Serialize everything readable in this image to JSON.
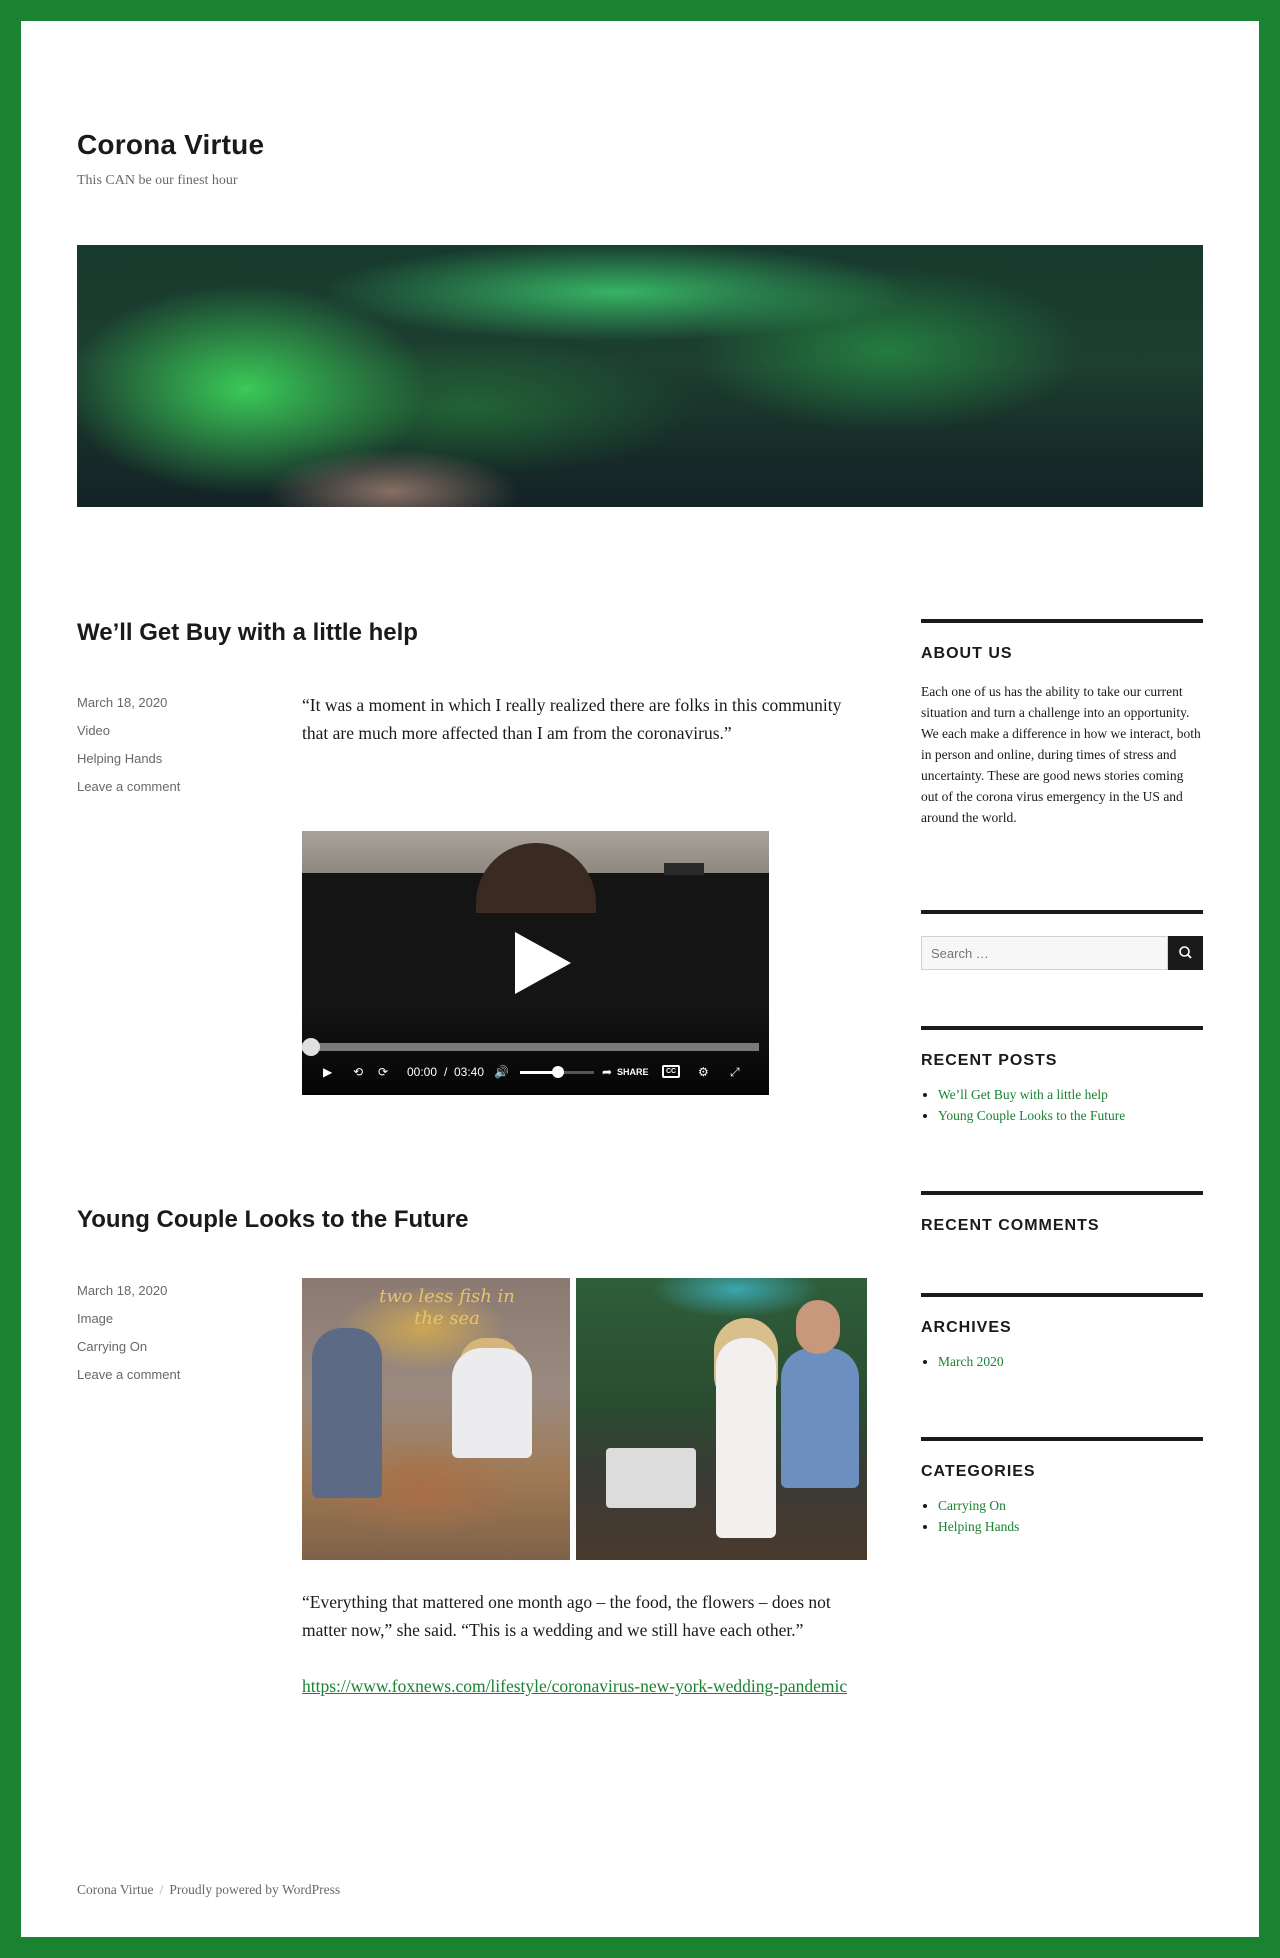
{
  "site": {
    "title": "Corona Virtue",
    "description": "This CAN be our finest hour"
  },
  "posts": [
    {
      "title": "We’ll Get Buy with a little help",
      "meta": {
        "date": "March 18, 2020",
        "format": "Video",
        "category": "Helping Hands",
        "comments": "Leave a comment"
      },
      "quote": "“It was a moment in which I really realized there are folks in this community that are much more affected than I am from the coronavirus.”",
      "video": {
        "time_current": "00:00",
        "time_separator": "/",
        "time_total": "03:40",
        "share_label": "SHARE",
        "cc_label": "CC",
        "volume_level": 0.52,
        "progress": 0
      }
    },
    {
      "title": "Young Couple Looks to the Future",
      "meta": {
        "date": "March 18, 2020",
        "format": "Image",
        "category": "Carrying On",
        "comments": "Leave a comment"
      },
      "image_text": "two less fish in the sea",
      "quote": "“Everything that mattered one month ago – the food, the flowers – does not matter now,” she said. “This is a wedding and we still have each other.”",
      "link": "https://www.foxnews.com/lifestyle/coronavirus-new-york-wedding-pandemic"
    }
  ],
  "sidebar": {
    "about": {
      "heading": "ABOUT US",
      "text": "Each one of us has the ability to take our current situation and turn a challenge into an opportunity.  We each make a difference in how we interact, both in person and online, during times of stress and uncertainty. These are good news stories coming out of the corona virus emergency in the US and around the world."
    },
    "search": {
      "placeholder": "Search …"
    },
    "recent_posts": {
      "heading": "RECENT POSTS",
      "items": [
        "We’ll Get Buy with a little help",
        "Young Couple Looks to the Future"
      ]
    },
    "recent_comments": {
      "heading": "RECENT COMMENTS"
    },
    "archives": {
      "heading": "ARCHIVES",
      "items": [
        "March 2020"
      ]
    },
    "categories": {
      "heading": "CATEGORIES",
      "items": [
        "Carrying On",
        "Helping Hands"
      ]
    }
  },
  "footer": {
    "site_name": "Corona Virtue",
    "separator": "/",
    "powered": "Proudly powered by WordPress"
  },
  "colors": {
    "accent": "#1a8331",
    "frame": "#1a8331",
    "text": "#1a1a1a",
    "muted": "#686868"
  }
}
